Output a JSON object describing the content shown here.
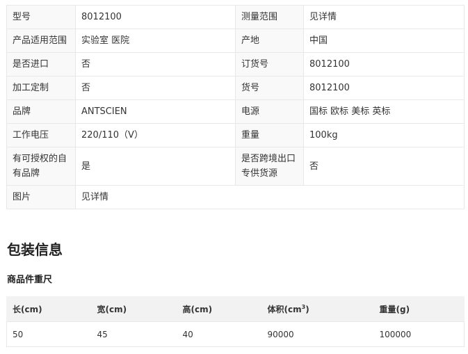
{
  "specs": {
    "rows": [
      {
        "k1": "型号",
        "v1": "8012100",
        "k2": "测量范围",
        "v2": "见详情"
      },
      {
        "k1": "产品适用范围",
        "v1": "实验室 医院",
        "k2": "产地",
        "v2": "中国"
      },
      {
        "k1": "是否进口",
        "v1": "否",
        "k2": "订货号",
        "v2": "8012100"
      },
      {
        "k1": "加工定制",
        "v1": "否",
        "k2": "货号",
        "v2": "8012100"
      },
      {
        "k1": "品牌",
        "v1": "ANTSCIEN",
        "k2": "电源",
        "v2": "国标 欧标 美标 英标"
      },
      {
        "k1": "工作电压",
        "v1": "220/110（V）",
        "k2": "重量",
        "v2": "100kg"
      },
      {
        "k1": "有可授权的自有品牌",
        "v1": "是",
        "k2": "是否跨境出口专供货源",
        "v2": "否"
      }
    ],
    "last_row": {
      "k1": "图片",
      "v1": "见详情"
    }
  },
  "packaging": {
    "title": "包装信息",
    "subtitle": "商品件重尺",
    "headers": {
      "length": "长(cm)",
      "width": "宽(cm)",
      "height": "高(cm)",
      "volume_base": "体积(cm",
      "volume_sup": "3",
      "volume_end": ")",
      "weight": "重量(g)"
    },
    "values": {
      "length": "50",
      "width": "45",
      "height": "40",
      "volume": "90000",
      "weight": "100000"
    }
  }
}
